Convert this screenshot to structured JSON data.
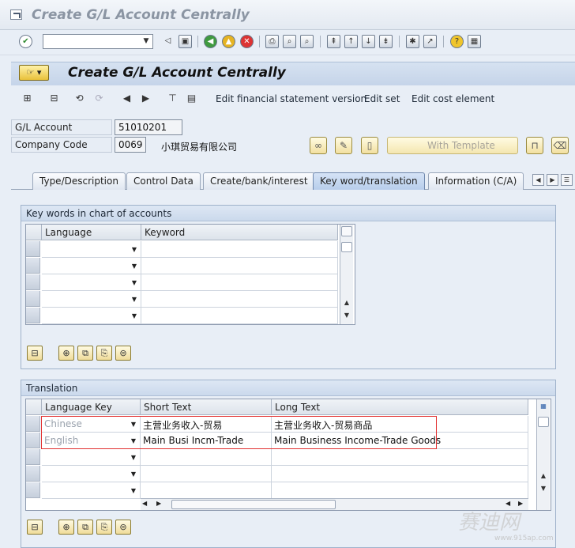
{
  "window": {
    "title": "Create G/L Account Centrally"
  },
  "screen": {
    "title": "Create G/L Account Centrally"
  },
  "app_toolbar": {
    "edit_fs_version": "Edit financial statement version",
    "edit_set": "Edit set",
    "edit_cost_element": "Edit cost element"
  },
  "fields": {
    "gl_account_label": "G/L Account",
    "gl_account_value": "51010201",
    "company_code_label": "Company Code",
    "company_code_value": "0069",
    "company_name": "小琪贸易有限公司"
  },
  "buttons": {
    "with_template": "With Template"
  },
  "tabs": [
    {
      "label": "Type/Description"
    },
    {
      "label": "Control Data"
    },
    {
      "label": "Create/bank/interest"
    },
    {
      "label": "Key word/translation",
      "active": true
    },
    {
      "label": "Information (C/A)"
    }
  ],
  "keywords_group": {
    "title": "Key words in chart of accounts",
    "columns": [
      "Language",
      "Keyword"
    ],
    "rows": [
      {
        "language": "",
        "keyword": ""
      },
      {
        "language": "",
        "keyword": ""
      },
      {
        "language": "",
        "keyword": ""
      },
      {
        "language": "",
        "keyword": ""
      },
      {
        "language": "",
        "keyword": ""
      }
    ]
  },
  "translation_group": {
    "title": "Translation",
    "columns": [
      "Language Key",
      "Short Text",
      "Long Text"
    ],
    "rows": [
      {
        "language": "Chinese",
        "short": "主营业务收入-贸易",
        "long": "主营业务收入-贸易商品"
      },
      {
        "language": "English",
        "short": "Main Busi Incm-Trade",
        "long": "Main Business Income-Trade Goods"
      },
      {
        "language": "",
        "short": "",
        "long": ""
      },
      {
        "language": "",
        "short": "",
        "long": ""
      },
      {
        "language": "",
        "short": "",
        "long": ""
      }
    ]
  },
  "watermark": {
    "text": "赛迪网",
    "url": "www.915ap.com"
  },
  "colors": {
    "highlight": "#e23030",
    "header_bg": "#c5d4e9",
    "active_tab": "#b7cdeb"
  }
}
